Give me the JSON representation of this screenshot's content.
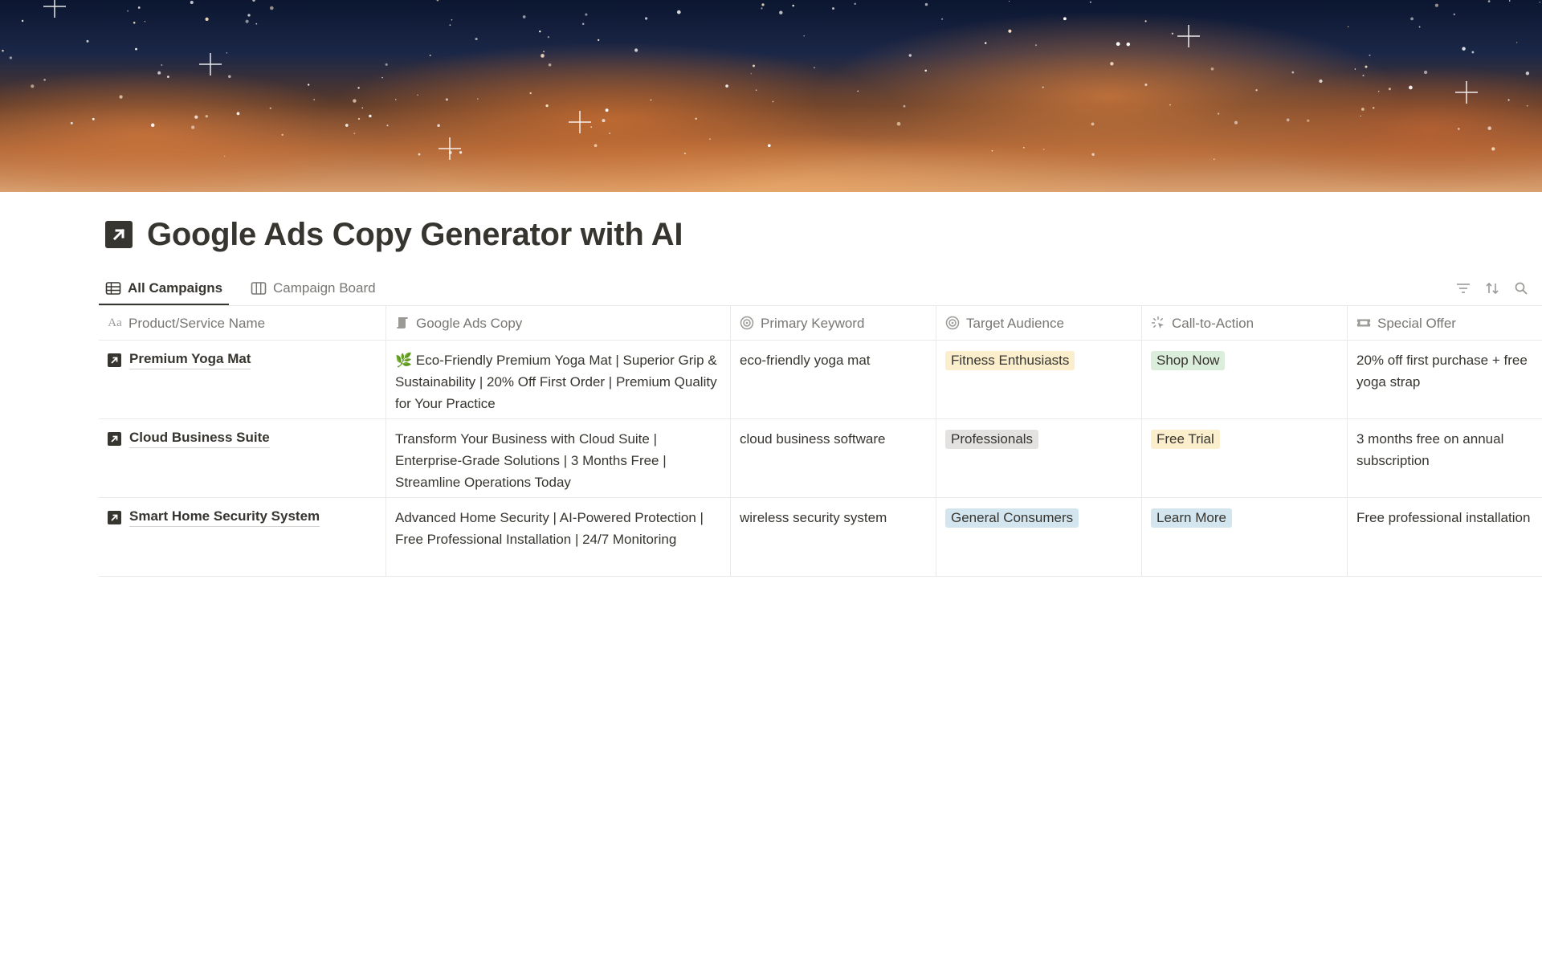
{
  "page": {
    "title": "Google Ads Copy Generator with AI",
    "icon": "arrow-up-right-square-icon"
  },
  "tabs": [
    {
      "label": "All Campaigns",
      "icon": "table-icon",
      "active": true
    },
    {
      "label": "Campaign Board",
      "icon": "board-icon",
      "active": false
    }
  ],
  "toolbar": {
    "icons": [
      "filter-icon",
      "sort-icon",
      "search-icon"
    ]
  },
  "table": {
    "columns": [
      {
        "label": "Product/Service Name",
        "icon": "Aa"
      },
      {
        "label": "Google Ads Copy",
        "icon": "scroll-icon"
      },
      {
        "label": "Primary Keyword",
        "icon": "target-icon"
      },
      {
        "label": "Target Audience",
        "icon": "target-icon"
      },
      {
        "label": "Call-to-Action",
        "icon": "click-icon"
      },
      {
        "label": "Special Offer",
        "icon": "ticket-icon"
      }
    ],
    "rows": [
      {
        "name": "Premium Yoga Mat",
        "ad_emoji": "🌿",
        "ad_copy": "Eco-Friendly Premium Yoga Mat | Superior Grip & Sustainability | 20% Off First Order | Premium Quality for Your Practice",
        "keyword": "eco-friendly yoga mat",
        "audience": "Fitness Enthusiasts",
        "audience_color": "#fbeecc",
        "cta": "Shop Now",
        "cta_color": "#dbeddb",
        "offer": "20% off first purchase + free yoga strap"
      },
      {
        "name": "Cloud Business Suite",
        "ad_emoji": "",
        "ad_copy": "Transform Your Business with Cloud Suite | Enterprise-Grade Solutions | 3 Months Free | Streamline Operations Today",
        "keyword": "cloud business software",
        "audience": "Professionals",
        "audience_color": "#e3e2e0",
        "cta": "Free Trial",
        "cta_color": "#fbeecc",
        "offer": "3 months free on annual subscription"
      },
      {
        "name": "Smart Home Security System",
        "ad_emoji": "",
        "ad_copy": "Advanced Home Security | AI-Powered Protection | Free Professional Installation | 24/7 Monitoring",
        "keyword": "wireless security system",
        "audience": "General Consumers",
        "audience_color": "#d3e5ef",
        "cta": "Learn More",
        "cta_color": "#d3e5ef",
        "offer": "Free professional installation"
      }
    ]
  }
}
